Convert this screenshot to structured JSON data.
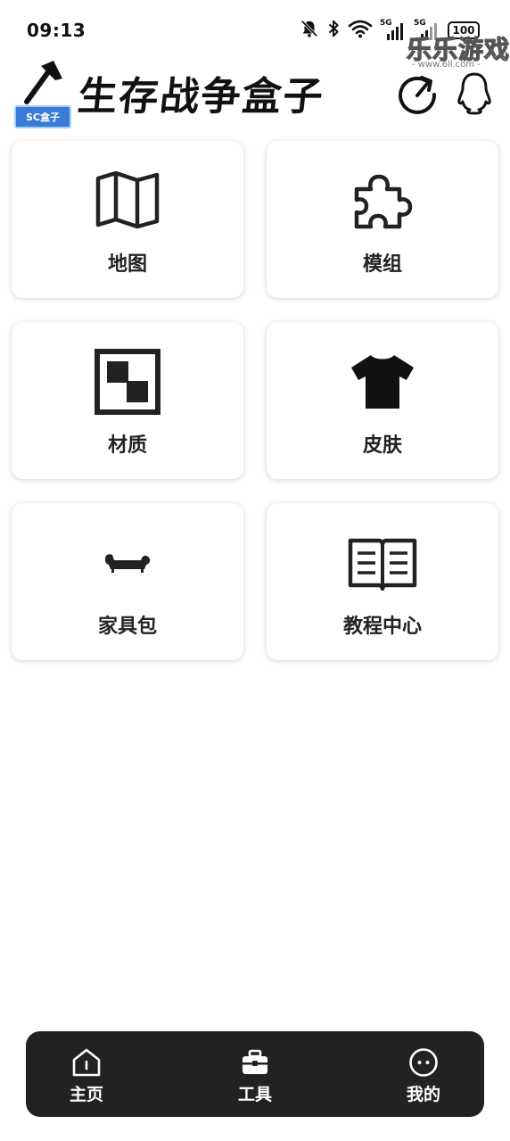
{
  "status_bar": {
    "time": "09:13",
    "signal_1_label": "5G",
    "signal_2_label": "5G",
    "battery": "100",
    "icons": [
      "bell-muted-icon",
      "bluetooth-icon",
      "wifi-icon",
      "cell-signal-icon",
      "cell-signal-icon",
      "battery-icon"
    ]
  },
  "watermark": {
    "title": "乐乐游戏",
    "url": "- www.6ll.com -"
  },
  "header": {
    "logo_badge_text": "SC盒子",
    "title": "生存战争盒子",
    "refresh_icon": "refresh-icon",
    "qq_icon": "qq-penguin-icon"
  },
  "menu": {
    "items": [
      {
        "label": "地图",
        "icon": "map-icon"
      },
      {
        "label": "模组",
        "icon": "puzzle-icon"
      },
      {
        "label": "材质",
        "icon": "texture-icon"
      },
      {
        "label": "皮肤",
        "icon": "tshirt-icon"
      },
      {
        "label": "家具包",
        "icon": "sofa-icon"
      },
      {
        "label": "教程中心",
        "icon": "book-icon"
      }
    ]
  },
  "bottom_nav": {
    "items": [
      {
        "label": "主页",
        "icon": "home-icon"
      },
      {
        "label": "工具",
        "icon": "toolbox-icon"
      },
      {
        "label": "我的",
        "icon": "profile-face-icon"
      }
    ]
  },
  "colors": {
    "background": "#ffffff",
    "nav_background": "#222222",
    "text": "#222222",
    "logo_blue": "#3a7bd5"
  }
}
